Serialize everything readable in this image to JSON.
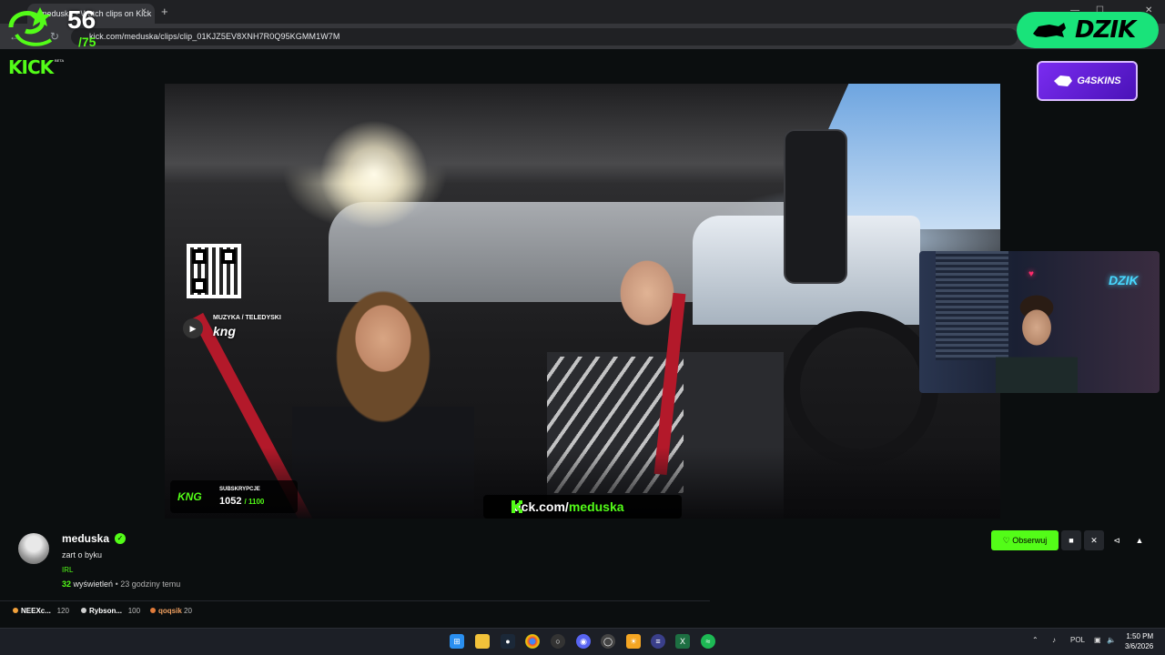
{
  "browser": {
    "tab_title": "meduska - Watch clips on Kick",
    "tab_close": "×",
    "new_tab": "+",
    "url": "kick.com/meduska/clips/clip_01KJZ5EV8XNH7R0Q95KGMM1W7M",
    "win_min": "—",
    "win_max": "☐",
    "win_close": "✕"
  },
  "overlay": {
    "count": "56",
    "total": "/75",
    "sponsor": "DZIK",
    "g4skins": "G4SKINS"
  },
  "kick": {
    "logo": "KICK",
    "beta": "BETA"
  },
  "video": {
    "music_label": "MUZYKA / TELEDYSKI",
    "music_name": "kng",
    "subs_logo": "KNG",
    "subs_label": "SUBSKRYPCJE",
    "subs_current": "1052",
    "subs_goal": "/ 1100",
    "subs_progress": 0.956,
    "kick_url_prefix": "kick.com/",
    "kick_url_channel": "meduska",
    "facecam_sign": "DZIK"
  },
  "clip": {
    "channel": "meduska",
    "title": "zart o byku",
    "category": "IRL",
    "views_count": "32",
    "views_label": "wyświetleń",
    "time_ago": "• 23 godziny temu",
    "follow_label": "Obserwuj"
  },
  "gifters": [
    {
      "name": "NEEXc...",
      "count": "120",
      "color": "#f2a13b"
    },
    {
      "name": "Rybson...",
      "count": "100",
      "color": "#d0d0d0"
    },
    {
      "name": "qoqsik",
      "count": "20",
      "color": "#e07b3a"
    }
  ],
  "taskbar": {
    "lang": "POL",
    "time": "1:50 PM",
    "date": "3/6/2026",
    "icons": [
      "windows-icon",
      "file-explorer-icon",
      "steam-icon",
      "chrome-icon",
      "obs-icon",
      "discord-icon",
      "app-icon",
      "app-icon-2",
      "app-icon-3",
      "excel-icon",
      "spotify-icon"
    ]
  },
  "colors": {
    "kick_green": "#53fc18",
    "dzik_green": "#19e37a",
    "g4_purple": "#7a2cf0",
    "belt_red": "#b3192a"
  }
}
